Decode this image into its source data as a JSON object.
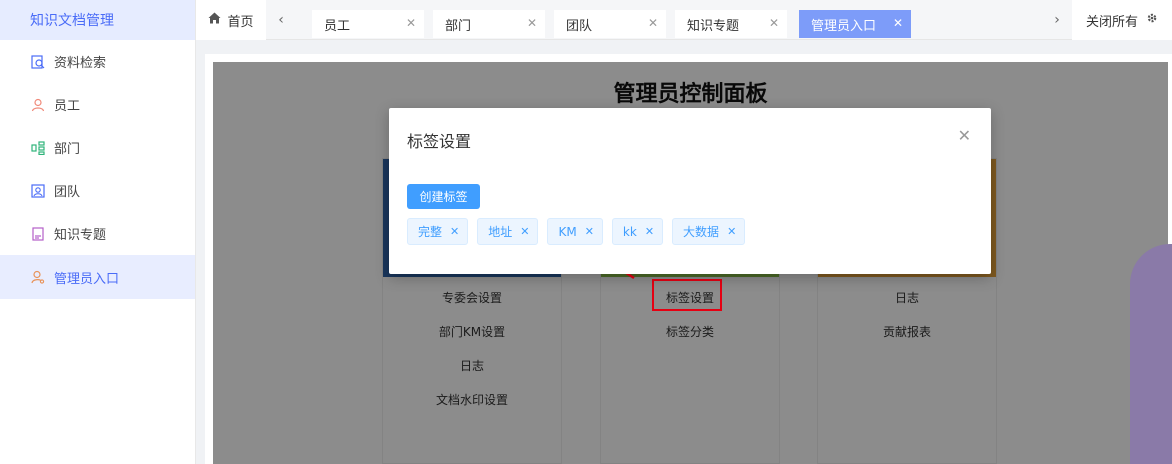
{
  "sidebar": {
    "title": "知识文档管理",
    "items": [
      {
        "label": "资料检索",
        "icon": "search-doc-icon"
      },
      {
        "label": "员工",
        "icon": "user-icon"
      },
      {
        "label": "部门",
        "icon": "org-icon"
      },
      {
        "label": "团队",
        "icon": "team-icon"
      },
      {
        "label": "知识专题",
        "icon": "topic-icon"
      },
      {
        "label": "管理员入口",
        "icon": "admin-icon"
      }
    ]
  },
  "tabs": {
    "home": "首页",
    "items": [
      {
        "label": "员工"
      },
      {
        "label": "部门"
      },
      {
        "label": "团队"
      },
      {
        "label": "知识专题"
      },
      {
        "label": "管理员入口"
      }
    ],
    "close_all": "关闭所有"
  },
  "panel": {
    "title": "管理员控制面板",
    "col1": [
      "专委会设置",
      "部门KM设置",
      "日志",
      "文档水印设置"
    ],
    "col2": [
      "标签设置",
      "标签分类"
    ],
    "col3": [
      "日志",
      "贡献报表"
    ]
  },
  "modal": {
    "title": "标签设置",
    "create_button": "创建标签",
    "tags": [
      "完整",
      "地址",
      "KM",
      "kk",
      "大数据"
    ]
  },
  "colors": {
    "accent": "#409eff",
    "active_tab": "#7d9cf9",
    "col1_bar": "#2f63a8",
    "col2_bar": "#8ac24a",
    "col3_bar": "#e5a23b",
    "highlight": "#e60012"
  }
}
